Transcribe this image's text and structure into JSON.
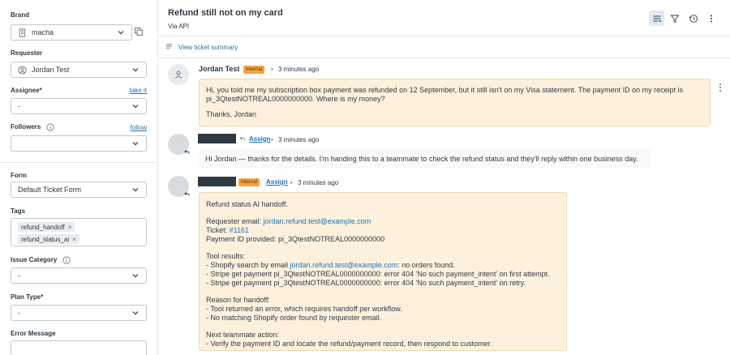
{
  "sidebar": {
    "brand": {
      "label": "Brand",
      "value": "macha"
    },
    "requester": {
      "label": "Requester",
      "value": "Jordan Test"
    },
    "assignee": {
      "label": "Assignee*",
      "link": "take it",
      "value": "-"
    },
    "followers": {
      "label": "Followers",
      "link": "follow",
      "value": ""
    },
    "form": {
      "label": "Form",
      "value": "Default Ticket Form"
    },
    "tags": {
      "label": "Tags",
      "items": [
        "refund_handoff",
        "refund_status_ai"
      ]
    },
    "issue_category": {
      "label": "Issue Category",
      "value": "-"
    },
    "plan_type": {
      "label": "Plan Type*",
      "value": "-"
    },
    "error_message": {
      "label": "Error Message",
      "value": ""
    }
  },
  "header": {
    "title": "Refund still not on my card",
    "via": "Via API"
  },
  "summary": {
    "link": "View ticket summary"
  },
  "conversation": [
    {
      "author": "Jordan Test",
      "badge": "Internal",
      "time": "3 minutes ago",
      "lines": [
        "Hi, you told me my subscription box payment was refunded on 12 September, but it still isn't on my Visa statement. The payment ID on my receipt is",
        "pi_3QtestNOTREAL0000000000. Where is my money?",
        "Thanks, Jordan"
      ]
    },
    {
      "assign": "Assign",
      "time": "3 minutes ago",
      "text": "Hi Jordan — thanks for the details. I'm handing this to a teammate to check the refund status and they'll reply within one business day."
    },
    {
      "badge": "Internal",
      "assign": "Assign",
      "time": "3 minutes ago",
      "heading": "Refund status AI handoff.",
      "requester_email_label": "Requester email: ",
      "requester_email": "jordan.refund.test@example.com",
      "ticket_label": "Ticket: ",
      "ticket_no": "#1161",
      "payment_line": "Payment ID provided: pi_3QtestNOTREAL0000000000",
      "tool_results_heading": "Tool results:",
      "tool_line1_prefix": "- Shopify search by email ",
      "tool_line1_email": "jordan.refund.test@example.com",
      "tool_line1_suffix": ": no orders found.",
      "tool_line2": "- Stripe get payment pi_3QtestNOTREAL0000000000: error 404 'No such payment_intent' on first attempt.",
      "tool_line3": "- Stripe get payment pi_3QtestNOTREAL0000000000: error 404 'No such payment_intent' on retry.",
      "reason_heading": "Reason for handoff:",
      "reason_line1": "- Tool returned an error, which requires handoff per workflow.",
      "reason_line2": "- No matching Shopify order found by requester email.",
      "next_heading": "Next teammate action:",
      "next_line1": "- Verify the payment ID and locate the refund/payment record, then respond to customer."
    }
  ],
  "icons": {
    "brand": "building-icon",
    "requester": "user-circle-icon",
    "copy": "copy-icon",
    "info": "info-icon",
    "chevron": "chevron-down-icon",
    "toolbar": [
      "conversations-icon",
      "filter-icon",
      "history-icon",
      "more-vertical-icon"
    ],
    "summary": "summary-icon",
    "reply": "reply-icon"
  },
  "colors": {
    "link": "#1f73b7",
    "internal_bg": "#fdf1de",
    "internal_badge": "#f5a442",
    "active_toolbar": "#e0e9f5"
  }
}
